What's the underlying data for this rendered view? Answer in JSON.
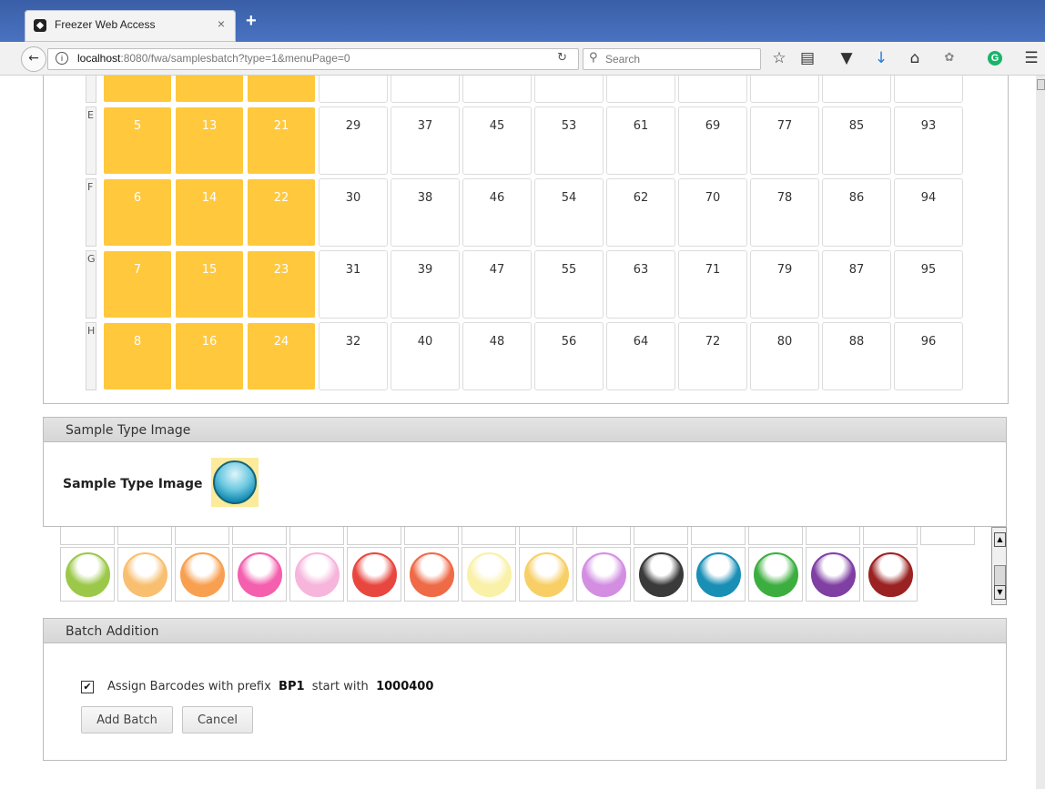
{
  "browser": {
    "tab_title": "Freezer Web Access",
    "tab_close": "×",
    "new_tab": "+",
    "url_host": "localhost",
    "url_rest": ":8080/fwa/samplesbatch?type=1&menuPage=0",
    "search_placeholder": "Search",
    "toolbar_icons": [
      "star-icon",
      "reading-list-icon",
      "pocket-icon",
      "download-icon",
      "home-icon",
      "extension-icon",
      "grammarly-icon",
      "menu-icon"
    ]
  },
  "grid": {
    "rows": [
      {
        "label": "E",
        "cells": [
          "5",
          "13",
          "21",
          "29",
          "37",
          "45",
          "53",
          "61",
          "69",
          "77",
          "85",
          "93"
        ]
      },
      {
        "label": "F",
        "cells": [
          "6",
          "14",
          "22",
          "30",
          "38",
          "46",
          "54",
          "62",
          "70",
          "78",
          "86",
          "94"
        ]
      },
      {
        "label": "G",
        "cells": [
          "7",
          "15",
          "23",
          "31",
          "39",
          "47",
          "55",
          "63",
          "71",
          "79",
          "87",
          "95"
        ]
      },
      {
        "label": "H",
        "cells": [
          "8",
          "16",
          "24",
          "32",
          "40",
          "48",
          "56",
          "64",
          "72",
          "80",
          "88",
          "96"
        ]
      }
    ],
    "selected_columns": 3,
    "selected_color": "#ffc83d"
  },
  "sample_type": {
    "header": "Sample Type Image",
    "label": "Sample Type Image",
    "selected_icon": "blue-circle-icon"
  },
  "palette": {
    "icons": [
      {
        "name": "lime-circle-icon",
        "color": "#9cc84a"
      },
      {
        "name": "light-orange-circle-icon",
        "color": "#f9bf70"
      },
      {
        "name": "orange-circle-icon",
        "color": "#f9a050"
      },
      {
        "name": "pink-circle-icon",
        "color": "#f45fae"
      },
      {
        "name": "light-pink-circle-icon",
        "color": "#f7b5dc"
      },
      {
        "name": "red-circle-icon",
        "color": "#e8473f"
      },
      {
        "name": "orange-red-circle-icon",
        "color": "#ef6a47"
      },
      {
        "name": "pale-yellow-circle-icon",
        "color": "#f9f1a8"
      },
      {
        "name": "gold-circle-icon",
        "color": "#f8cf65"
      },
      {
        "name": "violet-circle-icon",
        "color": "#d38ee2"
      },
      {
        "name": "black-circle-icon",
        "color": "#3a3a3a"
      },
      {
        "name": "blue-circle-icon",
        "color": "#1a8fb6"
      },
      {
        "name": "green-circle-icon",
        "color": "#3cae3f"
      },
      {
        "name": "purple-circle-icon",
        "color": "#7f3fa3"
      },
      {
        "name": "dark-red-circle-icon",
        "color": "#9b2222"
      }
    ]
  },
  "batch": {
    "header": "Batch Addition",
    "assign_text": "Assign Barcodes with prefix",
    "prefix": "BP1",
    "start_text": "start with",
    "start_value": "1000400",
    "add_label": "Add Batch",
    "cancel_label": "Cancel"
  }
}
